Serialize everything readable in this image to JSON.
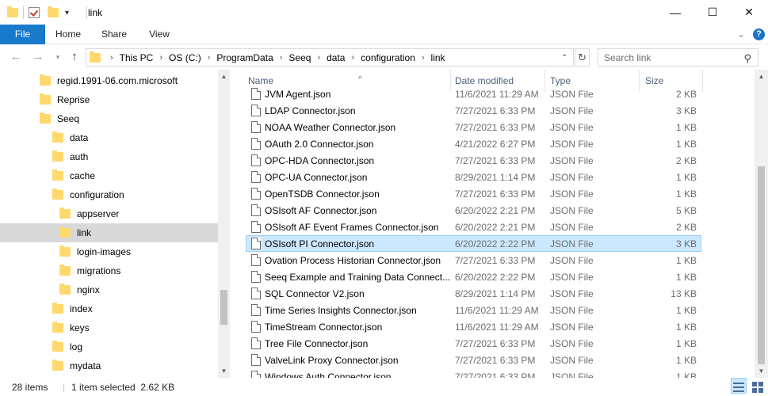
{
  "window": {
    "title": "link",
    "minimize": "—",
    "maximize": "☐",
    "close": "✕"
  },
  "ribbon": {
    "tabs": [
      {
        "label": "File"
      },
      {
        "label": "Home"
      },
      {
        "label": "Share"
      },
      {
        "label": "View"
      }
    ],
    "expand_glyph": "⌄",
    "help_glyph": "?"
  },
  "address": {
    "crumbs": [
      "This PC",
      "OS (C:)",
      "ProgramData",
      "Seeq",
      "data",
      "configuration",
      "link"
    ],
    "search_placeholder": "Search link"
  },
  "nav_tree": [
    {
      "label": "regid.1991-06.com.microsoft",
      "indent": 0
    },
    {
      "label": "Reprise",
      "indent": 0
    },
    {
      "label": "Seeq",
      "indent": 0
    },
    {
      "label": "data",
      "indent": 1
    },
    {
      "label": "auth",
      "indent": 2
    },
    {
      "label": "cache",
      "indent": 2
    },
    {
      "label": "configuration",
      "indent": 2
    },
    {
      "label": "appserver",
      "indent": 3
    },
    {
      "label": "link",
      "indent": 3,
      "selected": true
    },
    {
      "label": "login-images",
      "indent": 3
    },
    {
      "label": "migrations",
      "indent": 3
    },
    {
      "label": "nginx",
      "indent": 3
    },
    {
      "label": "index",
      "indent": 2
    },
    {
      "label": "keys",
      "indent": 2
    },
    {
      "label": "log",
      "indent": 2
    },
    {
      "label": "mydata",
      "indent": 2
    }
  ],
  "columns": {
    "name": "Name",
    "date": "Date modified",
    "type": "Type",
    "size": "Size"
  },
  "files": [
    {
      "name": "JVM Agent.json",
      "date": "11/6/2021 11:29 AM",
      "type": "JSON File",
      "size": "2 KB"
    },
    {
      "name": "LDAP Connector.json",
      "date": "7/27/2021 6:33 PM",
      "type": "JSON File",
      "size": "3 KB"
    },
    {
      "name": "NOAA Weather Connector.json",
      "date": "7/27/2021 6:33 PM",
      "type": "JSON File",
      "size": "1 KB"
    },
    {
      "name": "OAuth 2.0 Connector.json",
      "date": "4/21/2022 6:27 PM",
      "type": "JSON File",
      "size": "1 KB"
    },
    {
      "name": "OPC-HDA Connector.json",
      "date": "7/27/2021 6:33 PM",
      "type": "JSON File",
      "size": "2 KB"
    },
    {
      "name": "OPC-UA Connector.json",
      "date": "8/29/2021 1:14 PM",
      "type": "JSON File",
      "size": "1 KB"
    },
    {
      "name": "OpenTSDB Connector.json",
      "date": "7/27/2021 6:33 PM",
      "type": "JSON File",
      "size": "1 KB"
    },
    {
      "name": "OSIsoft AF Connector.json",
      "date": "6/20/2022 2:21 PM",
      "type": "JSON File",
      "size": "5 KB"
    },
    {
      "name": "OSIsoft AF Event Frames Connector.json",
      "date": "6/20/2022 2:21 PM",
      "type": "JSON File",
      "size": "2 KB"
    },
    {
      "name": "OSIsoft PI Connector.json",
      "date": "6/20/2022 2:22 PM",
      "type": "JSON File",
      "size": "3 KB",
      "selected": true
    },
    {
      "name": "Ovation Process Historian Connector.json",
      "date": "7/27/2021 6:33 PM",
      "type": "JSON File",
      "size": "1 KB"
    },
    {
      "name": "Seeq Example and Training Data Connect...",
      "date": "6/20/2022 2:22 PM",
      "type": "JSON File",
      "size": "1 KB"
    },
    {
      "name": "SQL Connector V2.json",
      "date": "8/29/2021 1:14 PM",
      "type": "JSON File",
      "size": "13 KB"
    },
    {
      "name": "Time Series Insights Connector.json",
      "date": "11/6/2021 11:29 AM",
      "type": "JSON File",
      "size": "1 KB"
    },
    {
      "name": "TimeStream Connector.json",
      "date": "11/6/2021 11:29 AM",
      "type": "JSON File",
      "size": "1 KB"
    },
    {
      "name": "Tree File Connector.json",
      "date": "7/27/2021 6:33 PM",
      "type": "JSON File",
      "size": "1 KB"
    },
    {
      "name": "ValveLink Proxy Connector.json",
      "date": "7/27/2021 6:33 PM",
      "type": "JSON File",
      "size": "1 KB"
    },
    {
      "name": "Windows Auth Connector.json",
      "date": "7/27/2021 6:33 PM",
      "type": "JSON File",
      "size": "1 KB"
    }
  ],
  "status": {
    "count": "28 items",
    "selection": "1 item selected  2.62 KB"
  },
  "colors": {
    "accent": "#1979ca",
    "selection_bg": "#cce8ff",
    "selection_border": "#99d1ff",
    "folder": "#ffd86e"
  }
}
